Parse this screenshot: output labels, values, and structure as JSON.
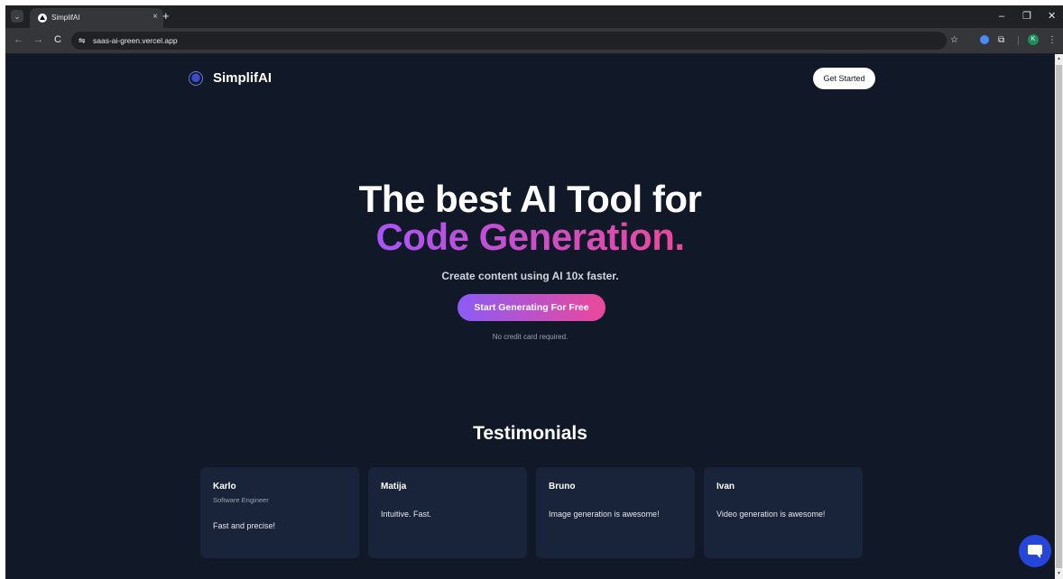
{
  "browser": {
    "tab_title": "SimplifAI",
    "tab_close": "×",
    "new_tab": "+",
    "url": "saas-ai-green.vercel.app",
    "window_controls": {
      "minimize": "–",
      "restore": "❐",
      "close": "✕"
    },
    "nav": {
      "back": "←",
      "forward": "→",
      "reload": "C"
    },
    "toolbar_icons": {
      "bookmark": "☆",
      "extensions": "⧉",
      "menu": "⋮"
    },
    "profile_initial": "K"
  },
  "site": {
    "brand": "SimplifAI",
    "get_started": "Get Started",
    "hero": {
      "line1": "The best AI Tool for",
      "line2": "Code Generation.",
      "subtitle": "Create content using AI 10x faster.",
      "cta": "Start Generating For Free",
      "note": "No credit card required."
    },
    "testimonials": {
      "title": "Testimonials",
      "items": [
        {
          "name": "Karlo",
          "role": "Software Engineer",
          "quote": "Fast and precise!"
        },
        {
          "name": "Matija",
          "quote": "Intuitive. Fast."
        },
        {
          "name": "Bruno",
          "quote": "Image generation is awesome!"
        },
        {
          "name": "Ivan",
          "quote": "Video generation is awesome!"
        }
      ]
    }
  },
  "colors": {
    "page_bg": "#111827",
    "card_bg": "#192339",
    "gradient_start": "#8b5cf6",
    "gradient_end": "#ec4899",
    "chat_button": "#2546d9"
  }
}
